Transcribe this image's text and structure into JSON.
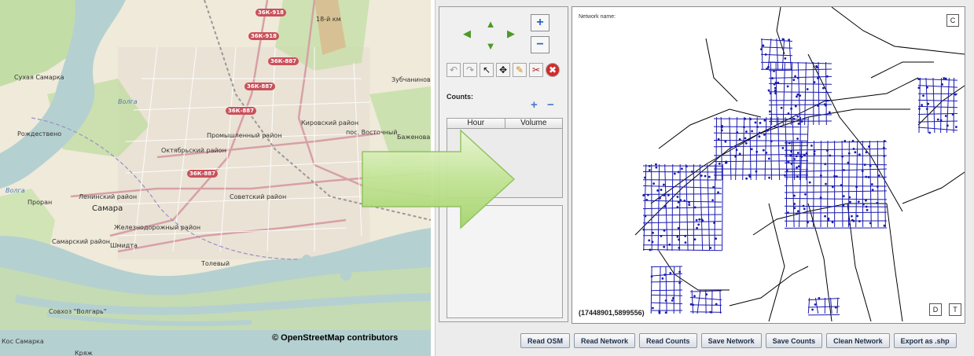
{
  "map": {
    "copyright": "© OpenStreetMap contributors",
    "labels": {
      "km18": "18-й км",
      "zubchaninovka": "Зубчаниновка",
      "rozhdestveno": "Рождествено",
      "promyshlenny": "Промышленный район",
      "kirovsky": "Кировский район",
      "vostochny": "пос. Восточный",
      "oktyabrsky": "Октябрьский район",
      "leninsky": "Ленинский район",
      "sovetsky": "Советский район",
      "samara": "Самара",
      "proran": "Проран",
      "zheleznodorozhny": "Железнодорожный район",
      "samarsky": "Самарский район",
      "shmidta": "Шмидта",
      "tolevy": "Толевый",
      "sovkhoz": "Совхоз \"Волгарь\"",
      "kryazh": "Кряж",
      "kos_samarka": "Кос Самарка",
      "volga1": "Волга",
      "volga2": "Волга",
      "bazhenova": "Баженова",
      "sukhaya": "Сухая Самарка"
    },
    "shields": [
      "36К-918",
      "36К-918",
      "36К-887",
      "36К-887",
      "36К-887",
      "36К-887"
    ]
  },
  "app": {
    "counts_label": "Counts:",
    "table_headers": [
      "Hour",
      "Volume"
    ],
    "network_name_label": "Network name:",
    "coords": "(17448901,5899556)",
    "corner_buttons": {
      "c": "C",
      "d": "D",
      "t": "T"
    },
    "buttons": [
      "Read OSM",
      "Read Network",
      "Read Counts",
      "Save Network",
      "Save Counts",
      "Clean Network",
      "Export as .shp"
    ],
    "zoom": {
      "in": "+",
      "out": "−"
    },
    "arrows": {
      "up": "▲",
      "down": "▼",
      "left": "◀",
      "right": "▶"
    },
    "icons": {
      "undo": "↶",
      "redo": "↷",
      "select": "↖",
      "move": "✥",
      "pencil": "✎",
      "cut": "✂",
      "delete": "✖"
    },
    "counts_add": "+",
    "counts_remove": "−"
  }
}
